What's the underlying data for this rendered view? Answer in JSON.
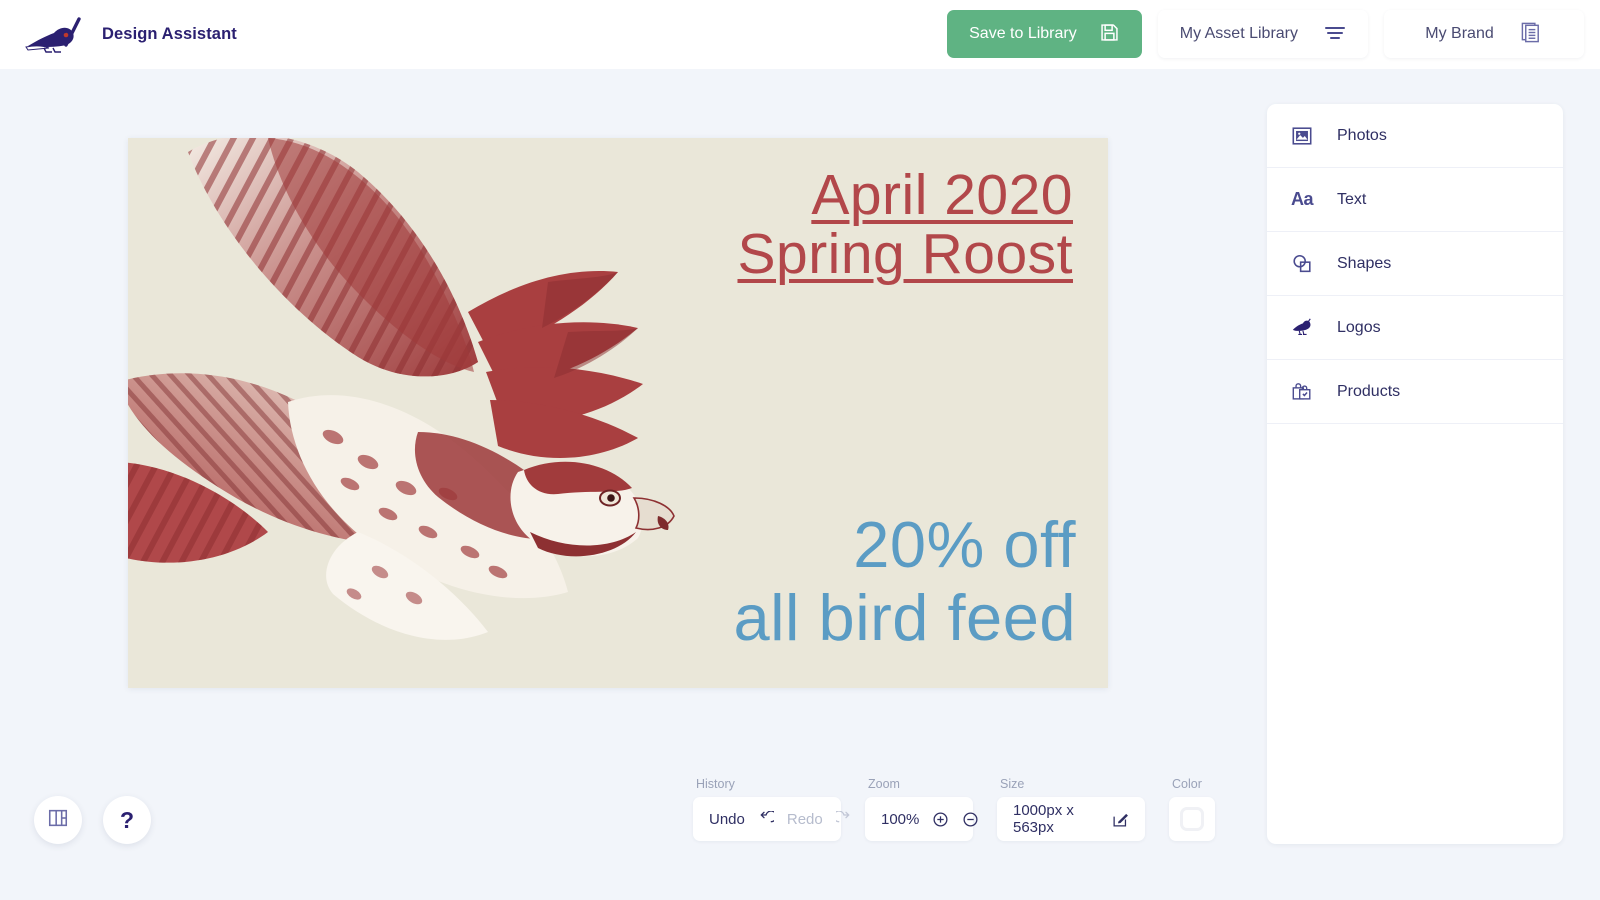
{
  "app": {
    "title": "Design Assistant",
    "logo_icon": "bird-with-paintbrush-logo",
    "accent_green": "#5fb383",
    "brand_navy": "#2b2071",
    "page_background": "#f2f5fa"
  },
  "header": {
    "save_button": {
      "label": "Save to Library",
      "icon": "floppy-disk-save-icon"
    },
    "asset_library_button": {
      "label": "My Asset Library",
      "icon": "filter-lines-icon"
    },
    "brand_button": {
      "label": "My Brand",
      "icon": "copy-stack-icon"
    }
  },
  "canvas": {
    "background_color": "#eae7d9",
    "artwork": "duotone-hawk-in-flight-photo",
    "headline": {
      "line1": "April 2020",
      "line2": "Spring Roost",
      "color": "#b2474a"
    },
    "subheadline": {
      "line1": "20% off",
      "line2": "all bird feed",
      "color": "#5b9cc4"
    }
  },
  "side_panel": {
    "items": [
      {
        "label": "Photos",
        "icon": "image-icon"
      },
      {
        "label": "Text",
        "icon": "text-aa-icon"
      },
      {
        "label": "Shapes",
        "icon": "shapes-icon"
      },
      {
        "label": "Logos",
        "icon": "bird-logo-icon"
      },
      {
        "label": "Products",
        "icon": "shopping-bag-icon"
      }
    ]
  },
  "toolbar": {
    "history": {
      "caption": "History",
      "undo_label": "Undo",
      "undo_icon": "undo-arrow-icon",
      "redo_label": "Redo",
      "redo_icon": "redo-arrow-icon",
      "redo_disabled": true
    },
    "zoom": {
      "caption": "Zoom",
      "value": "100%",
      "zoom_in_icon": "plus-circle-icon",
      "zoom_out_icon": "minus-circle-icon"
    },
    "size": {
      "caption": "Size",
      "value": "1000px x 563px",
      "edit_icon": "edit-pencil-square-icon"
    },
    "color": {
      "caption": "Color",
      "swatch_value": "#ffffff",
      "swatch_icon": "color-swatch-icon"
    }
  },
  "floating": {
    "panel_toggle_icon": "layout-panel-icon",
    "help_label": "?",
    "help_icon": "help-question-icon"
  }
}
